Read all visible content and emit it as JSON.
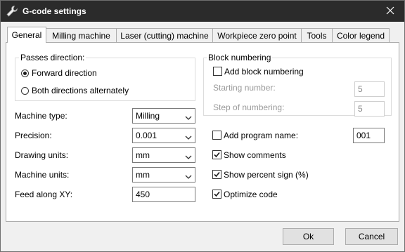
{
  "window": {
    "title": "G-code settings",
    "title_icon": "wrench-icon",
    "close_glyph": "✕"
  },
  "tabs": [
    {
      "label": "General"
    },
    {
      "label": "Milling machine"
    },
    {
      "label": "Laser (cutting) machine"
    },
    {
      "label": "Workpiece zero point"
    },
    {
      "label": "Tools"
    },
    {
      "label": "Color legend"
    }
  ],
  "passes": {
    "legend": "Passes direction:",
    "options": [
      {
        "label": "Forward direction",
        "checked": true
      },
      {
        "label": "Both directions alternately",
        "checked": false
      }
    ]
  },
  "block_numbering": {
    "legend": "Block numbering",
    "add_label": "Add block numbering",
    "starting_label": "Starting number:",
    "starting_value": "5",
    "step_label": "Step of numbering:",
    "step_value": "5"
  },
  "fields": {
    "machine_type": {
      "label": "Machine type:",
      "value": "Milling"
    },
    "precision": {
      "label": "Precision:",
      "value": "0.001"
    },
    "drawing_units": {
      "label": "Drawing units:",
      "value": "mm"
    },
    "machine_units": {
      "label": "Machine units:",
      "value": "mm"
    },
    "feed": {
      "label": "Feed along XY:",
      "value": "450"
    }
  },
  "options": {
    "program_name": {
      "label": "Add program name:",
      "value": "001",
      "checked": false
    },
    "show_comments": {
      "label": "Show comments",
      "checked": true
    },
    "show_percent": {
      "label": "Show percent sign (%)",
      "checked": true
    },
    "optimize": {
      "label": "Optimize code",
      "checked": true
    }
  },
  "buttons": {
    "ok": "Ok",
    "cancel": "Cancel"
  }
}
